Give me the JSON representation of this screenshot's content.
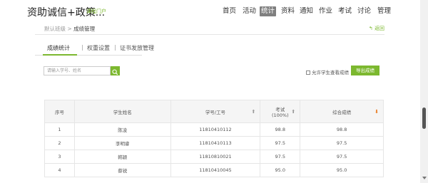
{
  "header": {
    "brand": "资助诚信+政策...",
    "brand_sub": "课程门户",
    "nav": [
      "首页",
      "活动",
      "统计",
      "资料",
      "通知",
      "作业",
      "考试",
      "讨论",
      "管理"
    ],
    "active_nav": "统计"
  },
  "breadcrumb": {
    "parent": "默认班级",
    "separator": ">",
    "current": "成绩管理",
    "back": "返回"
  },
  "tabs": [
    "成绩统计",
    "权重设置",
    "证书发放管理"
  ],
  "search": {
    "placeholder": "请输入学号、姓名"
  },
  "allow_view": {
    "label": "允许学生查看成绩",
    "checked": true
  },
  "export_label": "导出成绩",
  "table": {
    "headers": {
      "no": "序号",
      "name": "学生姓名",
      "id": "学号/工号",
      "exam": "考试",
      "exam_weight": "(100%)",
      "total": "综合成绩"
    },
    "rows": [
      {
        "no": "1",
        "name": "陈凌",
        "id": "11810410112",
        "exam": "98.8",
        "total": "98.8"
      },
      {
        "no": "2",
        "name": "李明睿",
        "id": "11810410113",
        "exam": "97.5",
        "total": "97.5"
      },
      {
        "no": "3",
        "name": "韩颖",
        "id": "11810810021",
        "exam": "97.5",
        "total": "97.5"
      },
      {
        "no": "4",
        "name": "蔡锐",
        "id": "11810410045",
        "exam": "95.0",
        "total": "95.0"
      }
    ]
  },
  "colors": {
    "accent": "#7cb82f",
    "sort_active": "#e8771a"
  }
}
